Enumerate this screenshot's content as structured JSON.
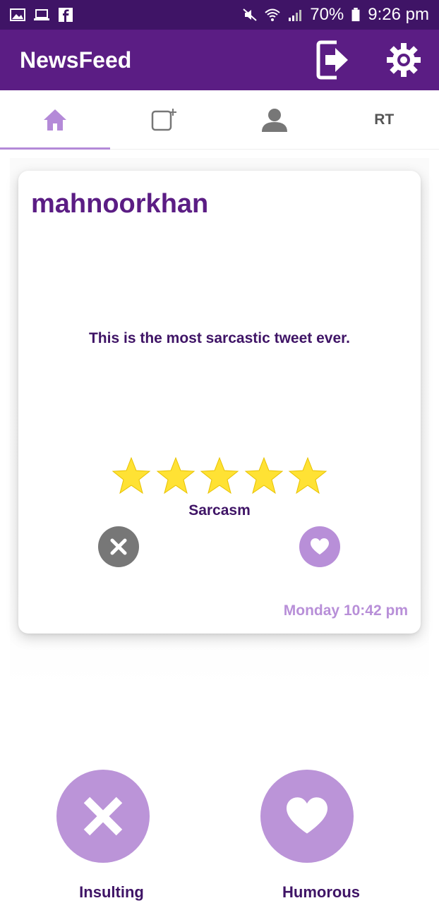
{
  "status_bar": {
    "battery": "70%",
    "time": "9:26 pm",
    "icons": [
      "image-icon",
      "laptop-icon",
      "facebook-icon",
      "mute-icon",
      "wifi-icon",
      "signal-icon",
      "battery-icon"
    ]
  },
  "app_bar": {
    "title": "NewsFeed",
    "icons": [
      "logout-icon",
      "settings-gear-icon"
    ]
  },
  "tabs": [
    {
      "icon": "home-icon",
      "label": "",
      "active": true
    },
    {
      "icon": "new-post-icon",
      "label": "",
      "active": false
    },
    {
      "icon": "profile-icon",
      "label": "",
      "active": false
    },
    {
      "icon": "",
      "label": "RT",
      "active": false
    }
  ],
  "card": {
    "username": "mahnoorkhan",
    "text": "This is the most sarcastic tweet ever.",
    "rating": {
      "value": 5,
      "max": 5
    },
    "label": "Sarcasm",
    "timestamp": "Monday 10:42 pm"
  },
  "actions": {
    "left_label": "Insulting",
    "right_label": "Humorous"
  },
  "colors": {
    "status_bar": "#3f1466",
    "app_bar": "#5b1d84",
    "accent_light": "#b88fd8",
    "text_dark": "#3f1466",
    "star": "#ffe234",
    "dismiss_gray": "#777777"
  }
}
